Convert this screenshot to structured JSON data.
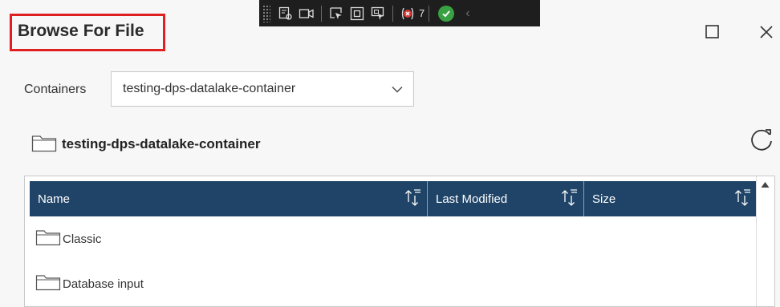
{
  "dialog": {
    "title": "Browse For File"
  },
  "debug_toolbar": {
    "error_count": "7",
    "icons": [
      "live-visual-tree-icon",
      "record-icon",
      "select-element-icon",
      "display-layout-adorners-icon",
      "track-focus-icon",
      "binding-failures-icon",
      "status-ok-icon",
      "collapse-chevron-icon"
    ]
  },
  "containers": {
    "label": "Containers",
    "selected": "testing-dps-datalake-container"
  },
  "breadcrumb": {
    "path": "testing-dps-datalake-container"
  },
  "table": {
    "columns": [
      {
        "label": "Name"
      },
      {
        "label": "Last Modified"
      },
      {
        "label": "Size"
      }
    ],
    "rows": [
      {
        "name": "Classic",
        "last_modified": "",
        "size": ""
      },
      {
        "name": "Database input",
        "last_modified": "",
        "size": ""
      }
    ]
  },
  "colors": {
    "header_bg": "#1f4468",
    "highlight_border": "#e02020"
  }
}
